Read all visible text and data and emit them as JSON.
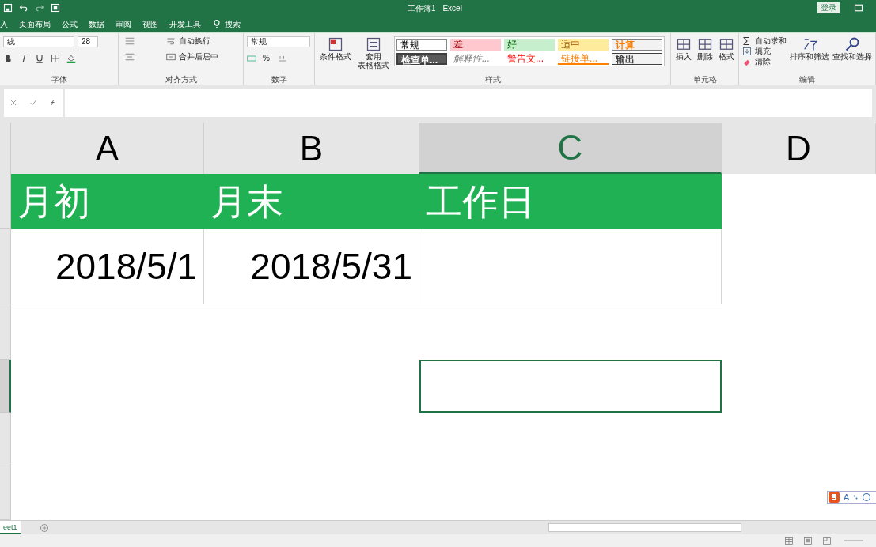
{
  "window": {
    "title": "工作簿1 - Excel",
    "login": "登录"
  },
  "menu_tabs": [
    "入",
    "页面布局",
    "公式",
    "数据",
    "审阅",
    "视图",
    "开发工具"
  ],
  "search": {
    "label": "搜索"
  },
  "ribbon": {
    "font": {
      "name": "线",
      "size": "28",
      "group": "字体"
    },
    "alignment": {
      "wrap": "自动换行",
      "merge": "合并后居中",
      "group": "对齐方式"
    },
    "number": {
      "format": "常规",
      "percent": "%",
      "group": "数字"
    },
    "styles": {
      "conditional": "条件格式",
      "table": [
        "套用",
        "表格格式"
      ],
      "group": "样式",
      "cells": [
        {
          "text": "常规",
          "kind": "normal"
        },
        {
          "text": "差",
          "kind": "bad"
        },
        {
          "text": "好",
          "kind": "good"
        },
        {
          "text": "适中",
          "kind": "neutral"
        },
        {
          "text": "计算",
          "kind": "calc"
        },
        {
          "text": "检查单...",
          "kind": "check"
        },
        {
          "text": "解释性...",
          "kind": "explain"
        },
        {
          "text": "警告文...",
          "kind": "warning"
        },
        {
          "text": "链接单...",
          "kind": "link"
        },
        {
          "text": "输出",
          "kind": "output"
        }
      ]
    },
    "cells": {
      "buttons": [
        "插入",
        "删除",
        "格式"
      ],
      "group": "单元格"
    },
    "editing": {
      "autosum": "自动求和",
      "fill": "填充",
      "clear": "清除",
      "sort": "排序和筛选",
      "find": "查找和选择",
      "group": "编辑"
    }
  },
  "columns": [
    {
      "label": "A",
      "selected": false
    },
    {
      "label": "B",
      "selected": false
    },
    {
      "label": "C",
      "selected": true
    },
    {
      "label": "D",
      "selected": false
    }
  ],
  "rows": [
    {
      "kind": "header",
      "selected": false,
      "cells": [
        "月初",
        "月末",
        "工作日"
      ]
    },
    {
      "kind": "data",
      "selected": false,
      "cells": [
        "2018/5/1",
        "2018/5/31"
      ]
    },
    {
      "kind": "blank",
      "selected": false
    },
    {
      "kind": "blank",
      "selected": true
    },
    {
      "kind": "blank",
      "selected": false
    },
    {
      "kind": "blank",
      "selected": false
    }
  ],
  "sheet_tabs": [
    {
      "label": "eet1",
      "selected": true
    }
  ],
  "ime_toolbar": {
    "label": "A"
  }
}
